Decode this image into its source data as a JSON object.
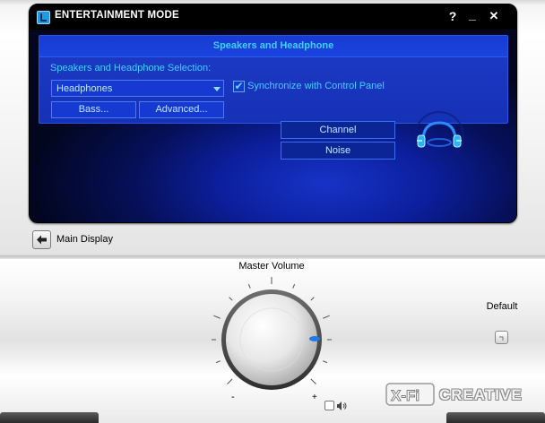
{
  "window": {
    "title": "ENTERTAINMENT MODE",
    "help_label": "?",
    "minimize_label": "_",
    "close_label": "✕"
  },
  "panel": {
    "header": "Speakers and Headphone",
    "selection_label": "Speakers and Headphone Selection:",
    "dropdown_value": "Headphones",
    "sync_checked": true,
    "sync_label": "Synchronize with Control Panel",
    "bass_button": "Bass...",
    "advanced_button": "Advanced...",
    "channel_button": "Channel",
    "noise_button": "Noise"
  },
  "nav": {
    "main_display_label": "Main Display"
  },
  "volume": {
    "label": "Master Volume",
    "minus_label": "-",
    "plus_label": "+",
    "default_label": "Default"
  },
  "branding": {
    "xfi": "X-Fi",
    "creative": "CREATIVE"
  },
  "colors": {
    "accent_text": "#3fd0ff",
    "panel_blue": "#1631b6",
    "screen_dark": "#02061f"
  }
}
